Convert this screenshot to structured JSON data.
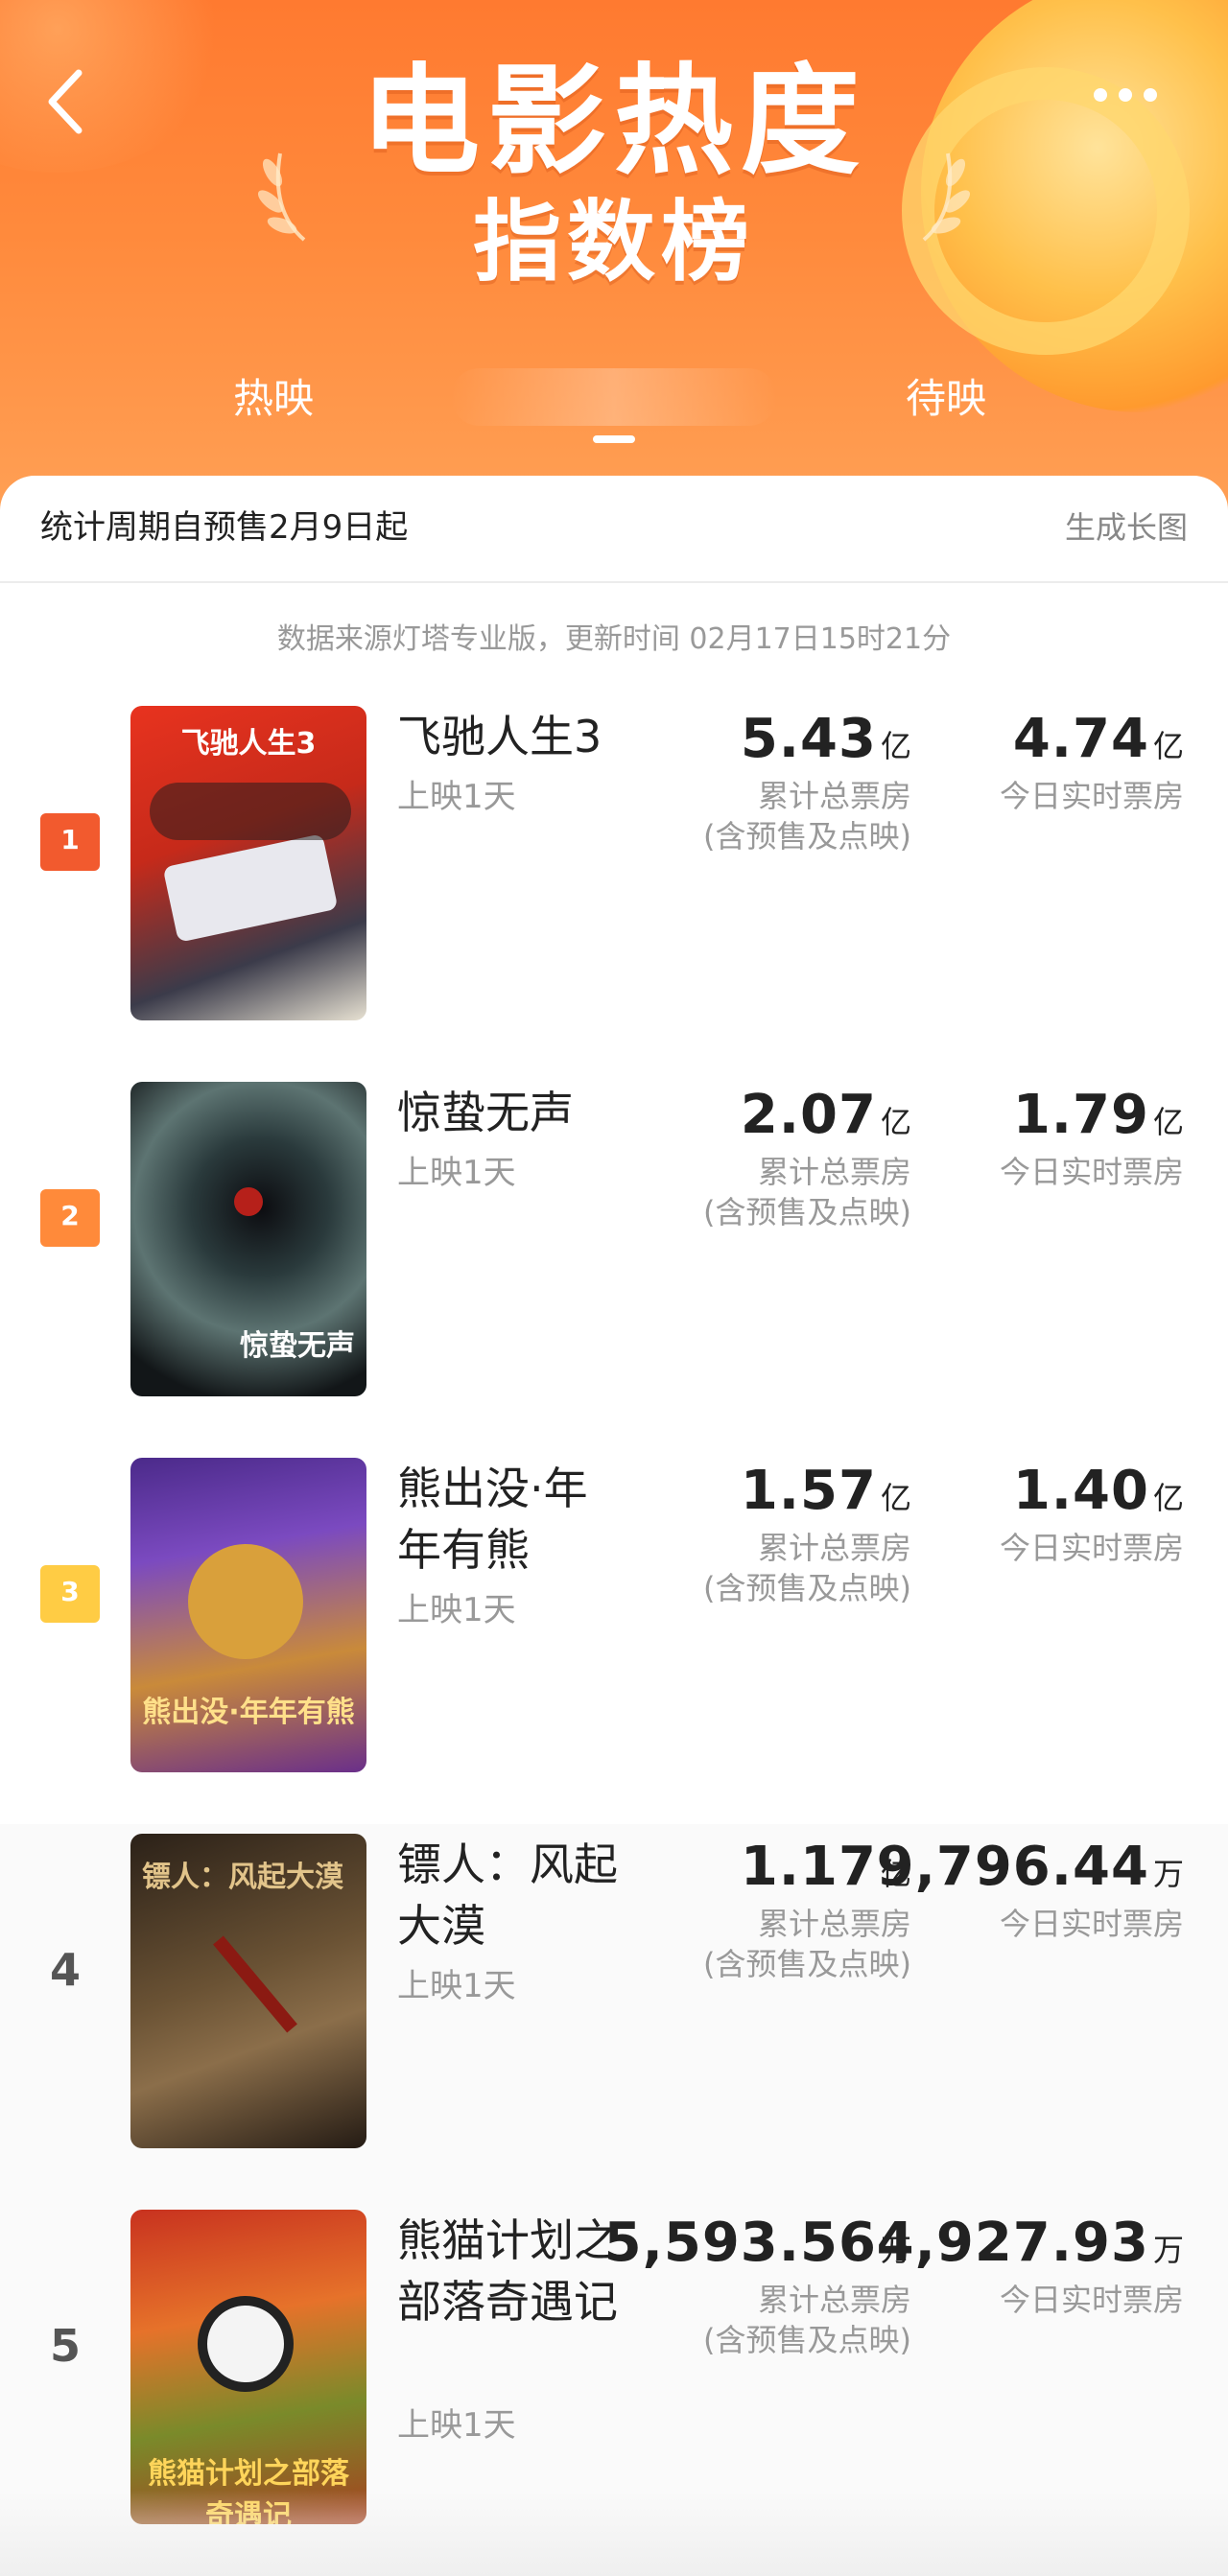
{
  "header": {
    "title_line1": "电影热度",
    "title_line2": "指数榜",
    "tabs": [
      {
        "label": "热映"
      },
      {
        "label": ""
      },
      {
        "label": "待映"
      }
    ]
  },
  "stats": {
    "period": "统计周期自预售2月9日起",
    "generate_long_image": "生成长图",
    "source": "数据来源灯塔专业版，更新时间 02月17日15时21分"
  },
  "labels": {
    "total_box": "累计总票房",
    "total_box_note": "(含预售及点映)",
    "today_box": "今日实时票房"
  },
  "colors": {
    "rank1": "#f25a2e",
    "rank2": "#ff8a3a",
    "rank3": "#ffcc44",
    "header_top": "#ff7a30"
  },
  "movies": [
    {
      "rank": "1",
      "title": "飞驰人生3",
      "release": "上映1天",
      "total_value": "5.43",
      "total_unit": "亿",
      "today_value": "4.74",
      "today_unit": "亿"
    },
    {
      "rank": "2",
      "title": "惊蛰无声",
      "release": "上映1天",
      "total_value": "2.07",
      "total_unit": "亿",
      "today_value": "1.79",
      "today_unit": "亿"
    },
    {
      "rank": "3",
      "title": "熊出没·年年有熊",
      "release": "上映1天",
      "total_value": "1.57",
      "total_unit": "亿",
      "today_value": "1.40",
      "today_unit": "亿"
    },
    {
      "rank": "4",
      "title": "镖人：风起大漠",
      "release": "上映1天",
      "total_value": "1.17",
      "total_unit": "亿",
      "today_value": "9,796.44",
      "today_unit": "万"
    },
    {
      "rank": "5",
      "title": "熊猫计划之部落奇遇记",
      "release": "上映1天",
      "total_value": "5,593.56",
      "total_unit": "万",
      "today_value": "4,927.93",
      "today_unit": "万"
    }
  ]
}
